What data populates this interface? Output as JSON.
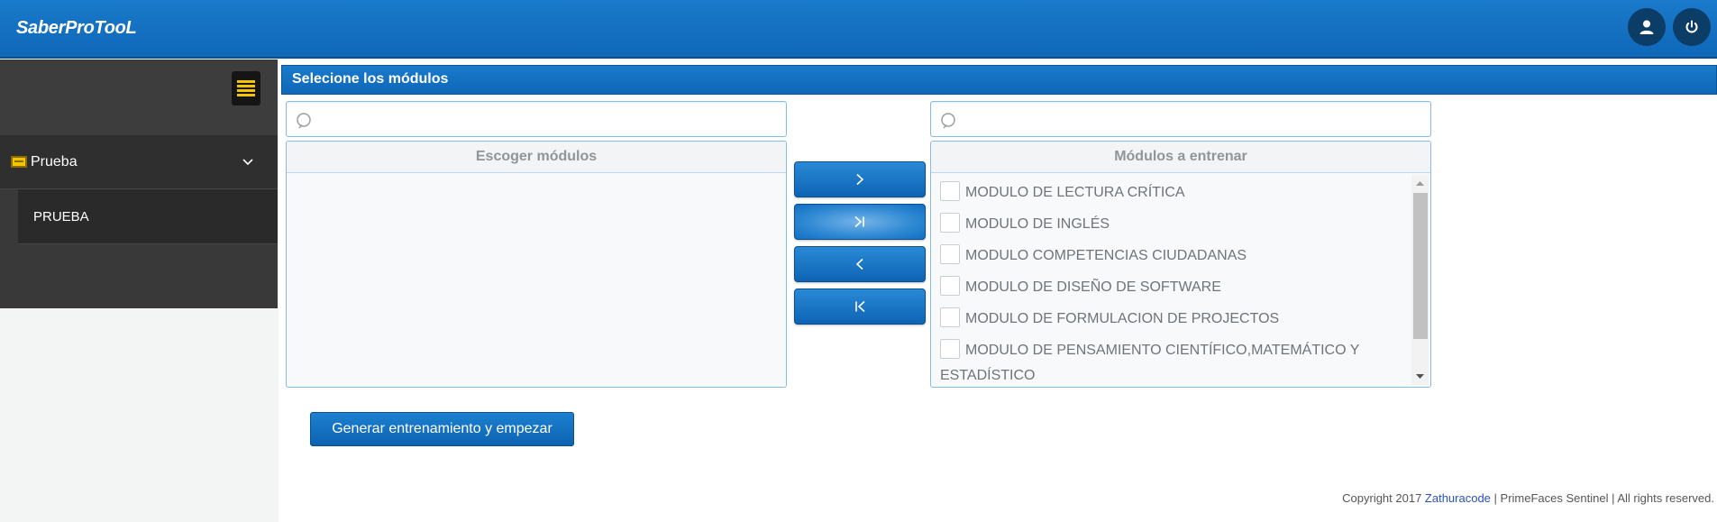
{
  "header": {
    "brand": "SaberProTooL",
    "icons": [
      "user-icon",
      "power-icon"
    ]
  },
  "sidebar": {
    "toggle_icon": "hamburger-menu-icon",
    "group": {
      "label": "Prueba",
      "icon": "card-icon",
      "chevron": "chevron-down-icon"
    },
    "items": [
      {
        "label": "PRUEBA"
      }
    ]
  },
  "panel": {
    "title": "Selecione los módulos",
    "source": {
      "caption": "Escoger módulos",
      "search_value": "",
      "items": []
    },
    "target": {
      "caption": "Módulos a entrenar",
      "search_value": "",
      "items": [
        {
          "label": "MODULO DE LECTURA CRÍTICA",
          "checked": false
        },
        {
          "label": "MODULO DE INGLÉS",
          "checked": false
        },
        {
          "label": "MODULO COMPETENCIAS CIUDADANAS",
          "checked": false
        },
        {
          "label": "MODULO DE DISEÑO DE SOFTWARE",
          "checked": false
        },
        {
          "label": "MODULO DE FORMULACION DE PROJECTOS",
          "checked": false
        },
        {
          "label": "MODULO DE PENSAMIENTO CIENTÍFICO,MATEMÁTICO Y ESTADÍSTICO",
          "checked": false
        }
      ]
    },
    "transfer_buttons": [
      {
        "icon": "chevron-right-icon",
        "name": "add"
      },
      {
        "icon": "chevron-bar-right-icon",
        "name": "add-all"
      },
      {
        "icon": "chevron-left-icon",
        "name": "remove"
      },
      {
        "icon": "bar-chevron-left-icon",
        "name": "remove-all"
      }
    ],
    "action_label": "Generar entrenamiento y empezar"
  },
  "footer": {
    "prefix": "Copyright 2017 ",
    "link": "Zathuracode",
    "suffix": " | PrimeFaces Sentinel | All rights reserved."
  },
  "colors": {
    "brand_blue": "#1273c4",
    "sidebar_dark": "#393939",
    "accent_yellow": "#f5c400"
  }
}
